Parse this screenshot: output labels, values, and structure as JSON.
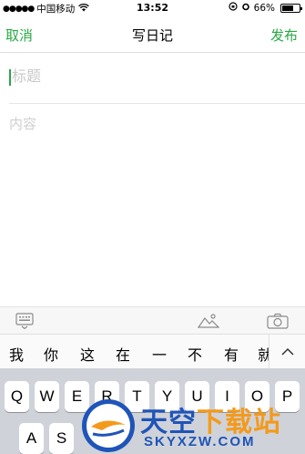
{
  "status_bar": {
    "carrier": "中国移动",
    "time": "13:52",
    "battery_percent": "66%",
    "battery_level": 0.66
  },
  "nav": {
    "cancel_label": "取消",
    "title": "写日记",
    "publish_label": "发布"
  },
  "editor": {
    "title_placeholder": "标题",
    "content_placeholder": "内容"
  },
  "candidates": [
    "我",
    "你",
    "这",
    "在",
    "一",
    "不",
    "有",
    "就"
  ],
  "keyboard": {
    "row1": [
      "Q",
      "W",
      "E",
      "R",
      "T",
      "Y",
      "U",
      "I",
      "O",
      "P"
    ],
    "row2": [
      "A",
      "S"
    ]
  },
  "watermark": {
    "text": "天空下载站",
    "url": "SKYXZW.COM"
  },
  "colors": {
    "accent": "#27a844",
    "watermark_blue": "#1f54b8",
    "watermark_orange": "#f39a1c"
  },
  "icons": {
    "toolbar": [
      "keyboard-hide-icon",
      "image-icon",
      "camera-icon"
    ],
    "status": [
      "wifi-icon",
      "lock-rotation-icon",
      "alarm-icon"
    ]
  }
}
